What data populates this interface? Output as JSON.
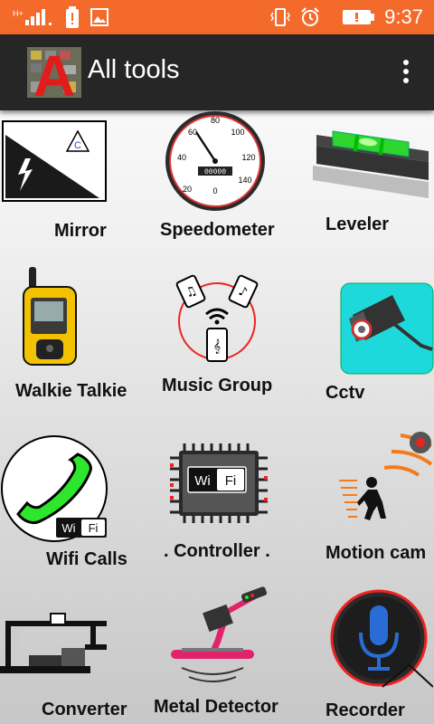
{
  "status_bar": {
    "time": "9:37",
    "left_icons": [
      "signal-icon",
      "alert-icon",
      "image-icon"
    ],
    "right_icons": [
      "vibrate-icon",
      "alarm-icon",
      "battery-icon"
    ],
    "background": "#f36a2b"
  },
  "app_bar": {
    "title": "All tools",
    "logo_letter": "A",
    "background": "#262626"
  },
  "tools": [
    {
      "label": "Mirror"
    },
    {
      "label": "Speedometer"
    },
    {
      "label": "Leveler"
    },
    {
      "label": "Walkie Talkie"
    },
    {
      "label": "Music Group"
    },
    {
      "label": "Cctv"
    },
    {
      "label": "Wifi Calls"
    },
    {
      "label": ". Controller ."
    },
    {
      "label": "Motion cam"
    },
    {
      "label": "Converter"
    },
    {
      "label": "Metal Detector"
    },
    {
      "label": "Recorder"
    }
  ],
  "icon_text": {
    "mirror_triangle": "C",
    "speedo_ticks": [
      "0",
      "20",
      "40",
      "60",
      "80",
      "100",
      "120",
      "140"
    ],
    "speedo_odometer": "00000",
    "wifi_badge_left": "Wi",
    "wifi_badge_right": "Fi"
  }
}
